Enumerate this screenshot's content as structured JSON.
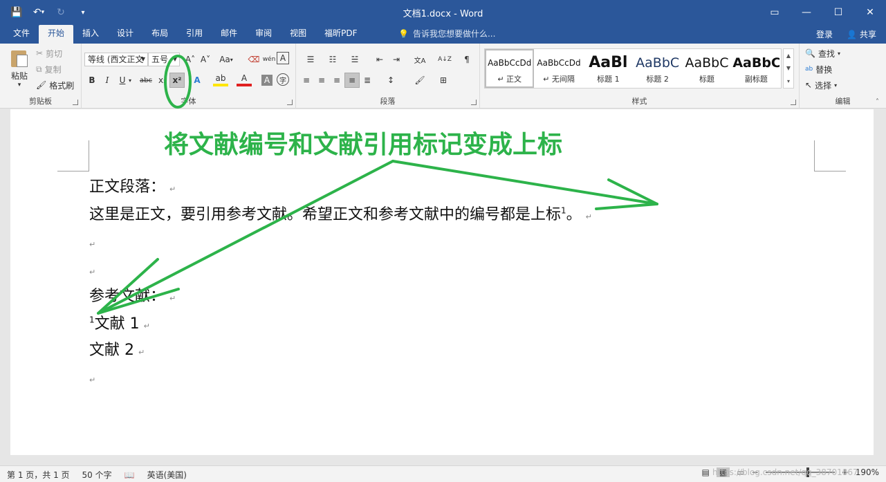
{
  "window": {
    "title": "文档1.docx - Word",
    "controls": {
      "ribbon_display": "▭",
      "minimize": "—",
      "maximize": "☐",
      "close": "✕"
    }
  },
  "qat": {
    "save": "💾",
    "undo": "↶",
    "undo_arrow": "▾",
    "redo": "↻",
    "customize": "▾"
  },
  "tabs": [
    "文件",
    "开始",
    "插入",
    "设计",
    "布局",
    "引用",
    "邮件",
    "审阅",
    "视图",
    "福昕PDF"
  ],
  "active_tab": "开始",
  "tell_me": {
    "icon": "💡",
    "placeholder": "告诉我您想要做什么..."
  },
  "account": {
    "login": "登录",
    "share_icon": "👤",
    "share": "共享"
  },
  "clipboard": {
    "paste": "粘贴",
    "paste_arrow": "▾",
    "cut": "剪切",
    "copy": "复制",
    "format_painter": "格式刷",
    "label": "剪贴板"
  },
  "font": {
    "font_name": "等线 (西文正文",
    "font_size": "五号",
    "grow": "A˄",
    "shrink": "A˅",
    "case": "Aa",
    "case_arrow": "▾",
    "clear": "⌫",
    "phonetic": "wén",
    "border": "A",
    "bold": "B",
    "italic": "I",
    "underline": "U",
    "underline_arrow": "▾",
    "strike": "abc",
    "subscript": "x₂",
    "superscript": "x²",
    "text_effects": "A",
    "highlight": "ab",
    "font_color": "A",
    "char_shading": "A",
    "enclose": "字",
    "label": "字体"
  },
  "paragraph": {
    "bullets": "☰",
    "numbering": "☷",
    "multilevel": "☱",
    "decrease_indent": "⇤",
    "increase_indent": "⇥",
    "chinese_layout": "文A",
    "sort": "A↓Z",
    "show_marks": "¶",
    "align_left": "≡",
    "align_center": "≡",
    "align_right": "≡",
    "justify": "≡",
    "distributed": "≣",
    "line_spacing": "↕",
    "shading": "🖌",
    "borders": "⊞",
    "label": "段落"
  },
  "styles": {
    "items": [
      {
        "preview": "AaBbCcDd",
        "name": "↵ 正文"
      },
      {
        "preview": "AaBbCcDd",
        "name": "↵ 无间隔"
      },
      {
        "preview": "AaBl",
        "name": "标题 1"
      },
      {
        "preview": "AaBbC",
        "name": "标题 2"
      },
      {
        "preview": "AaBbC",
        "name": "标题"
      },
      {
        "preview": "AaBbC",
        "name": "副标题"
      }
    ],
    "scroll_up": "▲",
    "scroll_down": "▼",
    "more": "▾",
    "label": "样式"
  },
  "editing": {
    "find": "查找",
    "find_icon": "🔍",
    "replace": "替换",
    "replace_icon": "ab",
    "select": "选择",
    "select_icon": "↖",
    "label": "编辑"
  },
  "document": {
    "annotation": "将文献编号和文献引用标记变成上标",
    "para_mark": "↵",
    "line1": "正文段落：",
    "line2_text": "这里是正文，要引用参考文献。希望正文和参考文献中的编号都是上标",
    "line2_sup": "1",
    "line2_end": "。",
    "line5": "参考文献：",
    "ref1_sup": "1",
    "ref1_text": "文献 1",
    "ref2_text": "文献 2",
    "annotation_color": "#2db34a"
  },
  "statusbar": {
    "page": "第 1 页，共 1 页",
    "words": "50 个字",
    "proofing_icon": "📖",
    "language": "英语(美国)",
    "zoom_minus": "−",
    "zoom_plus": "+",
    "zoom": "190%",
    "zoom_level": 0.62,
    "watermark": "https://blog.csdn.net/qq_38701867"
  }
}
